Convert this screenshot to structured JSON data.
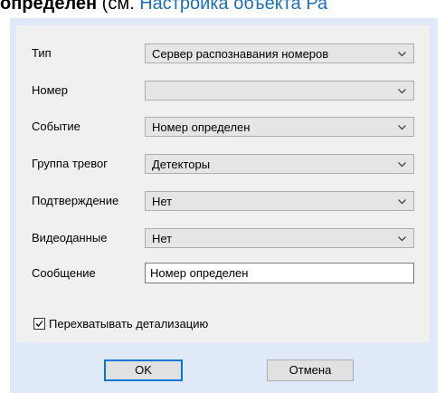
{
  "heading": {
    "bold_text": "определен",
    "plain_text": " (см. ",
    "link_text": "Настройка объекта Ра"
  },
  "dialog": {
    "rows": [
      {
        "label": "Тип",
        "value": "Сервер распознавания номеров"
      },
      {
        "label": "Номер",
        "value": ""
      },
      {
        "label": "Событие",
        "value": "Номер определен"
      },
      {
        "label": "Группа тревог",
        "value": "Детекторы"
      },
      {
        "label": "Подтверждение",
        "value": "Нет"
      },
      {
        "label": "Видеоданные",
        "value": "Нет"
      }
    ],
    "message": {
      "label": "Сообщение",
      "value": "Номер определен"
    },
    "intercept": {
      "label": "Перехватывать детализацию",
      "checked": true
    },
    "ok_label": "OK",
    "cancel_label": "Отмена"
  },
  "icons": {
    "combo_arrow": "chevron-down-icon",
    "checkbox_mark": "checkmark-icon"
  },
  "colors": {
    "dialog_background": "#dfe9f7",
    "panel_background": "#f0f0f0",
    "link": "#1e6fb8",
    "default_button_border": "#0078d7"
  }
}
